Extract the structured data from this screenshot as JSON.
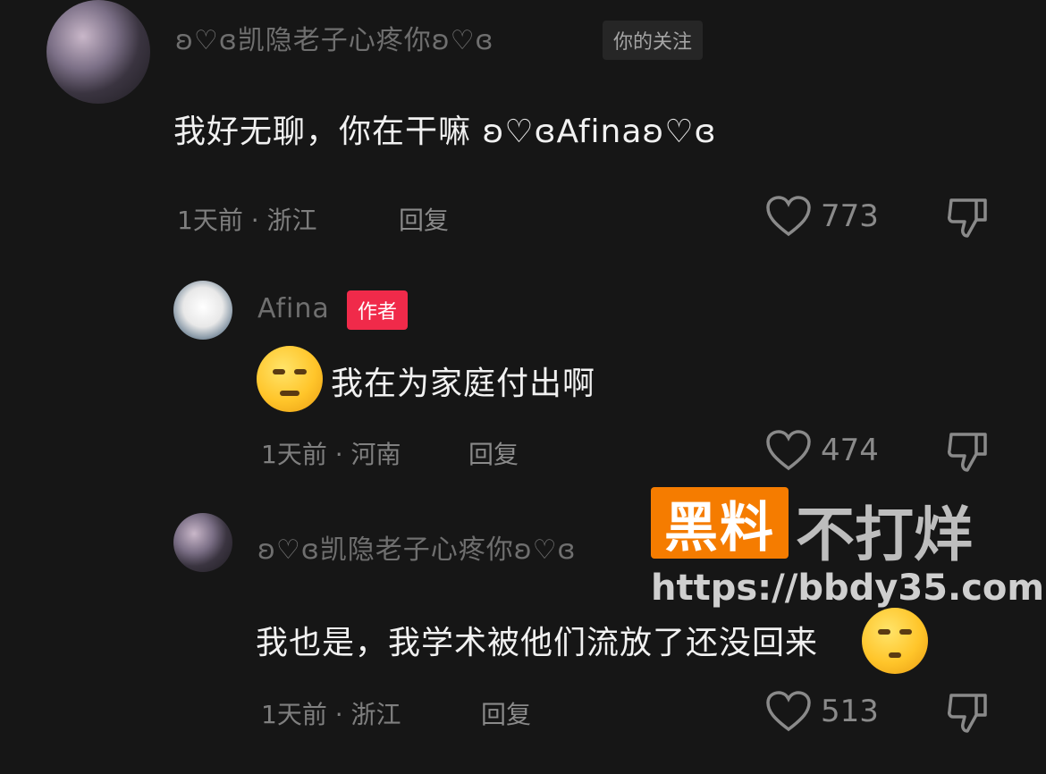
{
  "comments": [
    {
      "username": "ʚ♡ɞ凯隐老子心疼你ʚ♡ɞ",
      "badge": "你的关注",
      "text": "我好无聊，你在干嘛 ʚ♡ɞAfinaʚ♡ɞ",
      "meta": "1天前 · 浙江",
      "reply": "回复",
      "likes": "773"
    },
    {
      "username": "Afina",
      "badge": "作者",
      "text": "我在为家庭付出啊",
      "meta": "1天前 · 河南",
      "reply": "回复",
      "likes": "474"
    },
    {
      "username": "ʚ♡ɞ凯隐老子心疼你ʚ♡ɞ",
      "text": "我也是，我学术被他们流放了还没回来",
      "meta": "1天前 · 浙江",
      "reply": "回复",
      "likes": "513"
    }
  ],
  "watermark": {
    "brand": "黑料",
    "slogan": "不打烊",
    "url": "https://bbdy35.com"
  },
  "icons": {
    "like": "heart-outline-icon",
    "dislike": "thumbs-down-outline-icon"
  }
}
